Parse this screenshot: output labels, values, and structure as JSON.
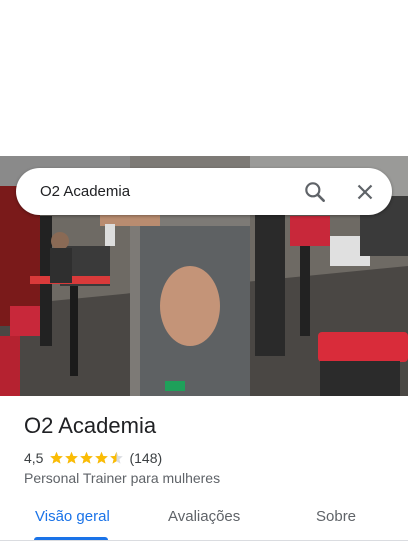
{
  "search": {
    "value": "O2 Academia",
    "search_icon": "search-icon",
    "close_icon": "close-icon"
  },
  "place": {
    "name": "O2 Academia",
    "rating": "4,5",
    "rating_value": 4.5,
    "review_count": "(148)",
    "category": "Personal Trainer para mulheres"
  },
  "tabs": [
    {
      "label": "Visão geral",
      "active": true
    },
    {
      "label": "Avaliações",
      "active": false
    },
    {
      "label": "Sobre",
      "active": false
    }
  ],
  "colors": {
    "accent": "#1a73e8",
    "star": "#fbbc04",
    "text_primary": "#202124",
    "text_secondary": "#5f6368"
  }
}
